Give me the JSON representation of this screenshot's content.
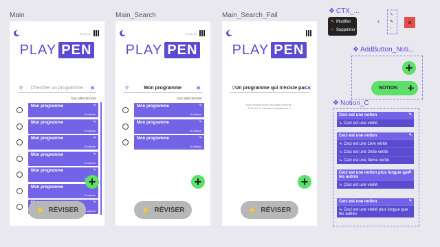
{
  "frames": {
    "main": "Main",
    "search": "Main_Search",
    "fail": "Main_Search_Fail"
  },
  "status_tiny": "11:01 pm",
  "logo": {
    "play": "PLAY",
    "pen": "PEN"
  },
  "main_screen": {
    "search_placeholder": "Chercher un programme",
    "select_all": "tout sélectionner",
    "items": [
      {
        "title": "Mon programme",
        "count": "0 notions"
      },
      {
        "title": "Mon programme",
        "count": "0 notions"
      },
      {
        "title": "Mon programme",
        "count": "0 notions"
      },
      {
        "title": "Mon programme",
        "count": "0 notions"
      },
      {
        "title": "Mon programme",
        "count": "0 notions"
      },
      {
        "title": "Mon programme",
        "count": "0 notions"
      },
      {
        "title": "Mon programme",
        "count": "0 notions"
      }
    ],
    "fab": "+",
    "review": "RÉVISER"
  },
  "search_screen": {
    "query": "Mon programme",
    "select_all": "tout sélectionner",
    "items": [
      {
        "title": "Mon programme",
        "count": "0 notions"
      },
      {
        "title": "Mon programme",
        "count": "0 notions"
      },
      {
        "title": "Mon programme",
        "count": "0 notions"
      }
    ],
    "fab": "+",
    "review": "RÉVISER"
  },
  "fail_screen": {
    "query": "Un programme qui n'existe pas",
    "empty_line1": "Aucun résultat trouvé pour cette recherche ?",
    "empty_line2": "Créez en un nouveau en appuyant sur",
    "fab": "+",
    "review": "RÉVISER"
  },
  "components": {
    "ctx_label": "CTX_...",
    "ctx_modify": "Modifier",
    "ctx_delete": "Supprimer",
    "add_label": "AddButton_Noti...",
    "add_plus": "+",
    "notion_btn": "NOTION",
    "notion_label": "Notion_C",
    "notions": [
      {
        "title": "Ceci est une notion",
        "truths": [
          "Ceci est une vérité"
        ]
      },
      {
        "title": "Ceci est une notion",
        "truths": [
          "Ceci est une 1ère vérité",
          "Ceci est une 2nde vérité",
          "Ceci est une 3ème vérité"
        ]
      },
      {
        "title": "Ceci est une notion plus longue que les autres",
        "truths": [
          "Ceci est une vérité"
        ]
      },
      {
        "title": "Ceci est une notion",
        "truths": [
          "Ceci est une vérité plus longue que les autres"
        ]
      }
    ]
  },
  "colors": {
    "accent": "#5a4bd1",
    "card": "#7363e6",
    "fab": "#5ddf6b",
    "close": "#e84b4b"
  },
  "icons": [
    "moon-icon",
    "qr-icon",
    "search-icon",
    "close-icon",
    "pencil-icon",
    "plus-icon",
    "bolt-icon",
    "trash-icon"
  ]
}
